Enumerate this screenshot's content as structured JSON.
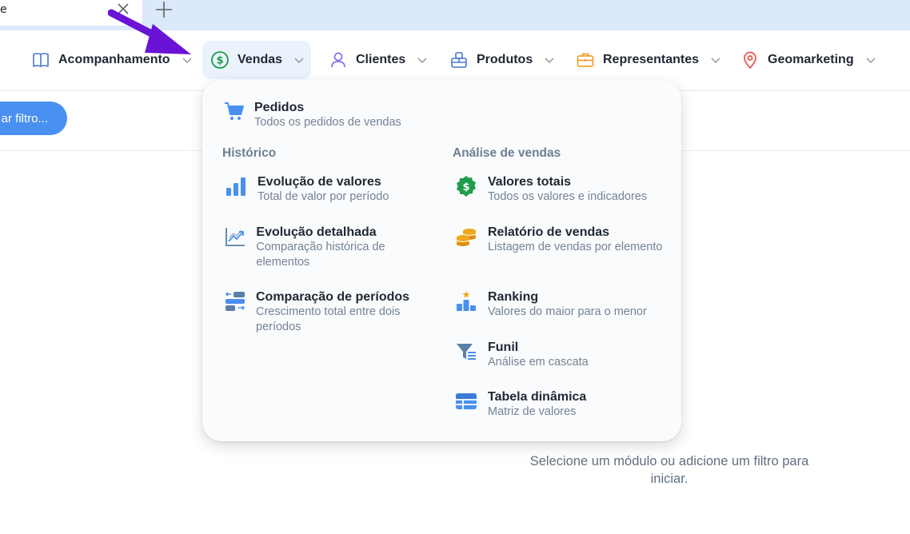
{
  "browser": {
    "tab_title": "e",
    "close_icon": "close-icon",
    "new_tab_icon": "plus-icon"
  },
  "nav": {
    "items": [
      {
        "label": "Acompanhamento",
        "icon": "book-icon"
      },
      {
        "label": "Vendas",
        "icon": "dollar-circle-icon",
        "active": true
      },
      {
        "label": "Clientes",
        "icon": "person-icon"
      },
      {
        "label": "Produtos",
        "icon": "box-icon"
      },
      {
        "label": "Representantes",
        "icon": "briefcase-icon"
      },
      {
        "label": "Geomarketing",
        "icon": "map-pin-icon"
      }
    ]
  },
  "filter_button": {
    "label": "ar filtro..."
  },
  "empty_state": {
    "message": "Selecione um módulo ou adicione um filtro para iniciar."
  },
  "dropdown": {
    "top_item": {
      "title": "Pedidos",
      "desc": "Todos os pedidos de vendas",
      "icon": "cart-icon"
    },
    "left_section": {
      "title": "Histórico",
      "items": [
        {
          "title": "Evolução de valores",
          "desc": "Total de valor por período",
          "icon": "bar-chart-icon"
        },
        {
          "title": "Evolução detalhada",
          "desc": "Comparação histórica de elementos",
          "icon": "trend-chart-icon"
        },
        {
          "title": "Comparação de períodos",
          "desc": "Crescimento total entre dois períodos",
          "icon": "compare-icon"
        }
      ]
    },
    "right_section": {
      "title": "Análise de vendas",
      "items": [
        {
          "title": "Valores totais",
          "desc": "Todos os valores e indicadores",
          "icon": "dollar-badge-icon"
        },
        {
          "title": "Relatório de vendas",
          "desc": "Listagem de vendas por elemento",
          "icon": "coins-icon"
        },
        {
          "title": "Ranking",
          "desc": "Valores do maior para o menor",
          "icon": "ranking-icon"
        },
        {
          "title": "Funil",
          "desc": "Análise em cascata",
          "icon": "funnel-icon"
        },
        {
          "title": "Tabela dinâmica",
          "desc": "Matriz de valores",
          "icon": "table-icon"
        }
      ]
    }
  },
  "colors": {
    "accent": "#4a90f0",
    "active_bg": "#eaf2fd",
    "money_green": "#1e9e4a",
    "coin_orange": "#f0a81c",
    "pin_red": "#e8504a",
    "briefcase_orange": "#f0a030",
    "person_purple": "#8a6cf0",
    "arrow_purple": "#6a12d6"
  }
}
